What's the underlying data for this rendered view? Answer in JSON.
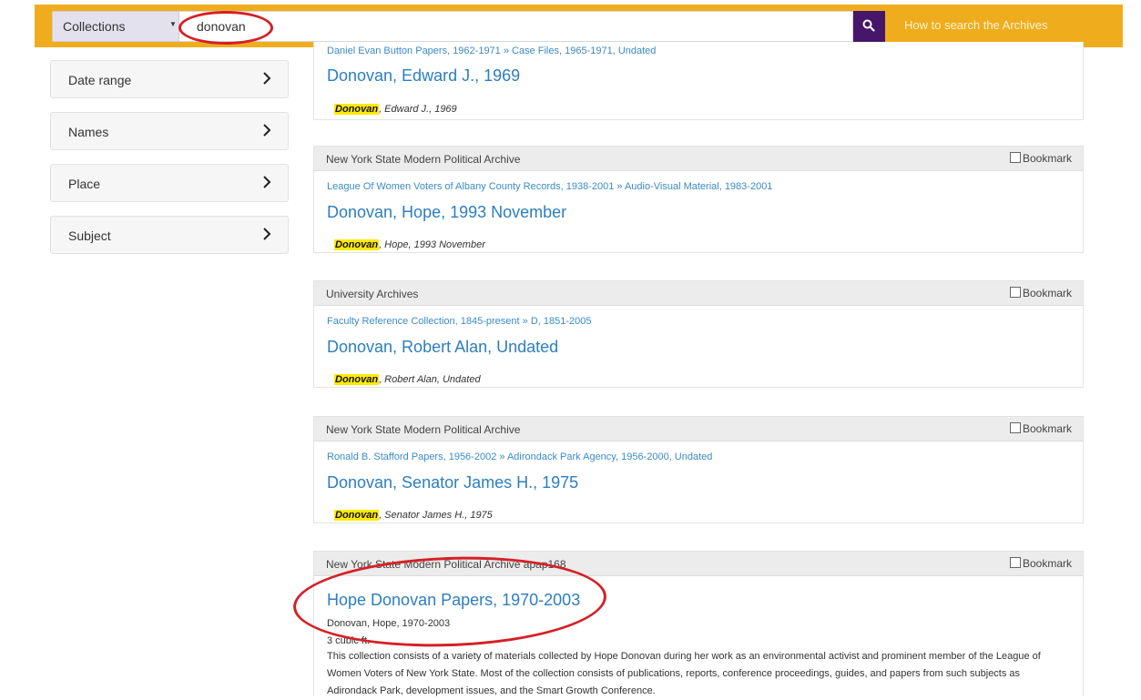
{
  "header": {
    "scope_label": "Collections",
    "search_value": "donovan",
    "help_link": "How to search the Archives"
  },
  "facets": [
    {
      "label": "Date range"
    },
    {
      "label": "Names"
    },
    {
      "label": "Place"
    },
    {
      "label": "Subject"
    }
  ],
  "bookmark_label": "Bookmark",
  "results": {
    "r0": {
      "breadcrumb": "Daniel Evan Button Papers, 1962-1971 » Case Files, 1965-1971, Undated",
      "title": "Donovan, Edward J., 1969",
      "highlight": "Donovan",
      "snippet_rest": ", Edward J., 1969"
    },
    "r1": {
      "repository": "New York State Modern Political Archive",
      "breadcrumb_a": "League Of Women Voters of Albany County Records, 1938-2001",
      "breadcrumb_sep": "»",
      "breadcrumb_b": "Audio-Visual Material, 1983-2001",
      "title": "Donovan, Hope, 1993 November",
      "highlight": "Donovan",
      "snippet_rest": ", Hope, 1993 November"
    },
    "r2": {
      "repository": "University Archives",
      "breadcrumb_a": "Faculty Reference Collection, 1845-present",
      "breadcrumb_sep": "»",
      "breadcrumb_b": "D, 1851-2005",
      "title": "Donovan, Robert Alan, Undated",
      "highlight": "Donovan",
      "snippet_rest": ", Robert Alan, Undated"
    },
    "r3": {
      "repository": "New York State Modern Political Archive",
      "breadcrumb_a": "Ronald B. Stafford Papers, 1956-2002",
      "breadcrumb_sep": "»",
      "breadcrumb_b": "Adirondack Park Agency, 1956-2000, Undated",
      "title": "Donovan, Senator James H., 1975",
      "highlight": "Donovan",
      "snippet_rest": ", Senator James H., 1975"
    },
    "r4": {
      "repository": "New York State Modern Political Archive",
      "identifier": "apap168",
      "title": "Hope Donovan Papers, 1970-2003",
      "names": "Donovan, Hope, 1970-2003",
      "extent": "3 cubic ft.",
      "description": "This collection consists of a variety of materials collected by Hope Donovan during her work as an environmental activist and prominent member of the League of Women Voters of New York State. Most of the collection consists of publications, reports, conference proceedings, guides, and papers from such subjects as Adirondack Park, development issues, and the Smart Growth Conference."
    }
  },
  "colors": {
    "header_bg": "#efad1d",
    "search_button": "#46166b",
    "link": "#2d7ec0",
    "highlight": "#ffea00",
    "annotation": "#d61f26"
  }
}
